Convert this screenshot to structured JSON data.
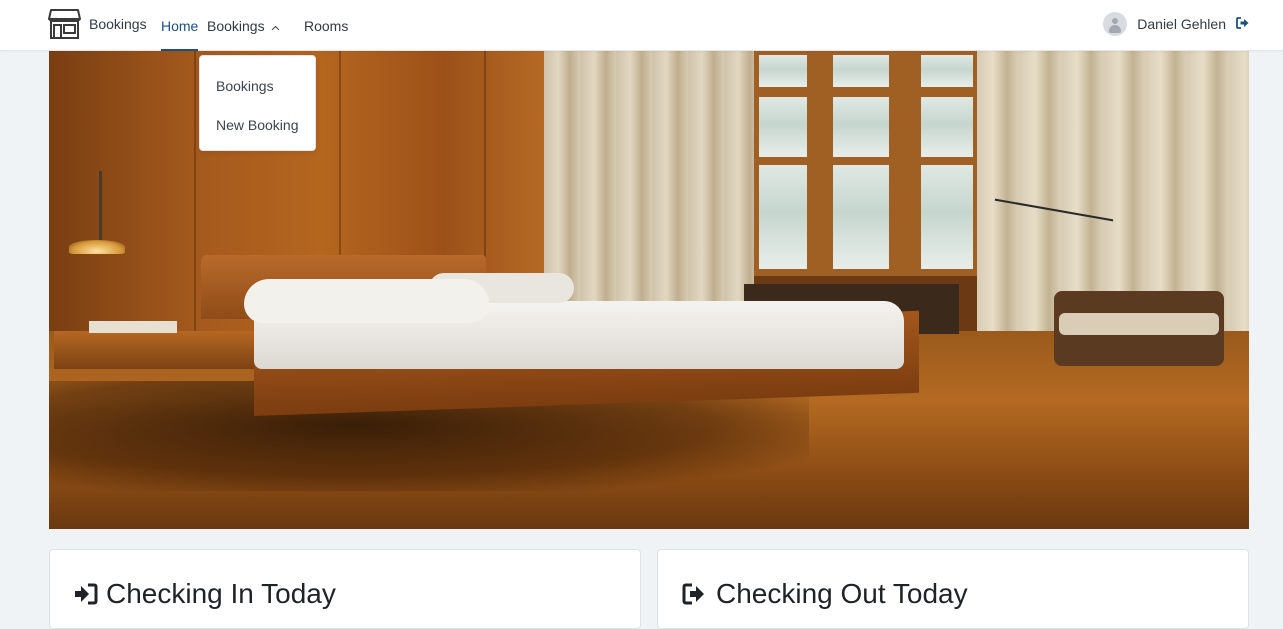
{
  "navbar": {
    "brand_label": "Bookings",
    "links": {
      "home": "Home",
      "bookings": "Bookings",
      "rooms": "Rooms"
    },
    "active": "home",
    "user_name": "Daniel Gehlen",
    "icons": {
      "brand": "store-icon",
      "bookings_caret": "chevron-up-icon",
      "avatar": "user-avatar-icon",
      "logout": "sign-out-icon"
    },
    "accent_color": "#1d4f80"
  },
  "bookings_dropdown": {
    "expanded": true,
    "items": [
      "Bookings",
      "New Booking"
    ]
  },
  "hero": {
    "image_kind": "photo"
  },
  "cards": {
    "checking_in": {
      "title": "Checking In Today",
      "icon": "sign-in-icon"
    },
    "checking_out": {
      "title": "Checking Out Today",
      "icon": "sign-out-icon"
    }
  }
}
